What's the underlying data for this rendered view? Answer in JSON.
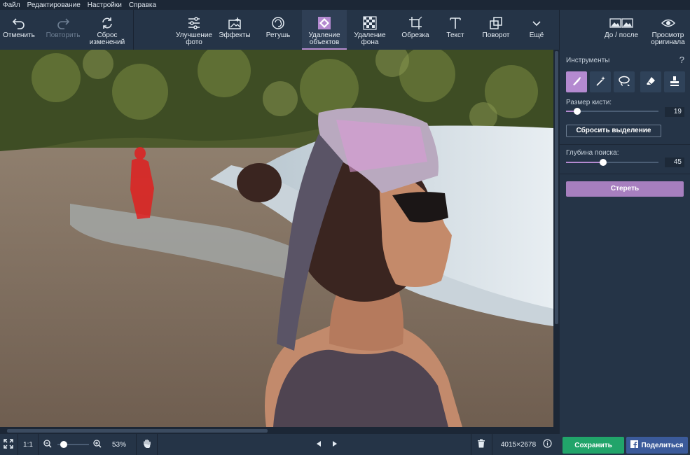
{
  "menu": [
    "Файл",
    "Редактирование",
    "Настройки",
    "Справка"
  ],
  "toolbar": {
    "undo": "Отменить",
    "redo": "Повторить",
    "reset": "Сброс\nизменений",
    "enhance": "Улучшение\nфото",
    "effects": "Эффекты",
    "retouch": "Ретушь",
    "object_removal": "Удаление\nобъектов",
    "bg_removal": "Удаление\nфона",
    "crop": "Обрезка",
    "text": "Текст",
    "rotate": "Поворот",
    "more": "Ещё",
    "before_after": "До / после",
    "view_original": "Просмотр\nоригинала"
  },
  "panel": {
    "title": "Инструменты",
    "help": "?",
    "brush_size_label": "Размер кисти:",
    "brush_size_value": "19",
    "brush_size_fraction": 0.12,
    "reset_selection": "Сбросить выделение",
    "search_depth_label": "Глубина поиска:",
    "search_depth_value": "45",
    "search_depth_fraction": 0.4,
    "erase": "Стереть"
  },
  "statusbar": {
    "one_to_one": "1:1",
    "zoom": "53%",
    "zoom_fraction": 0.2,
    "dimensions": "4015×2678",
    "save": "Сохранить",
    "share": "Поделиться"
  },
  "colors": {
    "accent": "#b48ad0",
    "save": "#21a46a",
    "share": "#3b5a9a",
    "selection_mask": "#e02020"
  },
  "icons": {
    "tools": [
      "brush-icon",
      "magic-wand-icon",
      "lasso-icon",
      "eraser-icon",
      "stamp-icon"
    ]
  }
}
